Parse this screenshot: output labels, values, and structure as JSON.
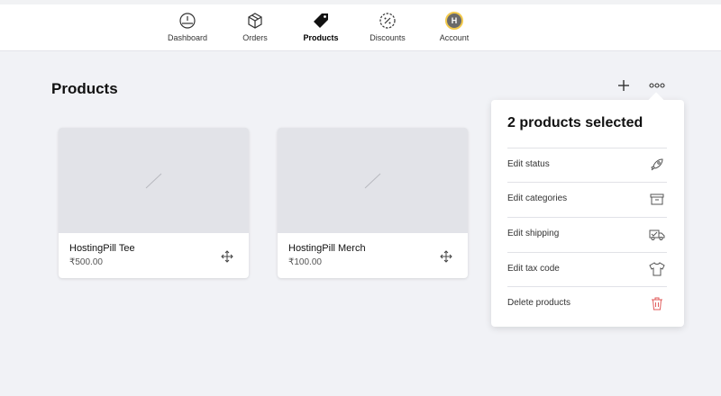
{
  "nav": {
    "items": [
      {
        "label": "Dashboard",
        "icon": "dashboard-gauge-icon"
      },
      {
        "label": "Orders",
        "icon": "box-icon"
      },
      {
        "label": "Products",
        "icon": "tag-icon",
        "active": true
      },
      {
        "label": "Discounts",
        "icon": "discount-badge-icon"
      },
      {
        "label": "Account",
        "icon": "avatar",
        "avatar_letter": "H"
      }
    ]
  },
  "page": {
    "title": "Products"
  },
  "products": [
    {
      "name": "HostingPill Tee",
      "price": "₹500.00"
    },
    {
      "name": "HostingPill Merch",
      "price": "₹100.00"
    }
  ],
  "selection_menu": {
    "heading": "2 products selected",
    "items": [
      {
        "label": "Edit status",
        "icon": "rocket-icon"
      },
      {
        "label": "Edit categories",
        "icon": "archive-box-icon"
      },
      {
        "label": "Edit shipping",
        "icon": "truck-icon"
      },
      {
        "label": "Edit tax code",
        "icon": "tshirt-icon"
      },
      {
        "label": "Delete products",
        "icon": "trash-icon",
        "color": "#e05a5a"
      }
    ]
  },
  "colors": {
    "background": "#f1f2f6",
    "placeholder": "#e2e3e8",
    "danger": "#e05a5a",
    "avatar_ring": "#f1c84b"
  }
}
